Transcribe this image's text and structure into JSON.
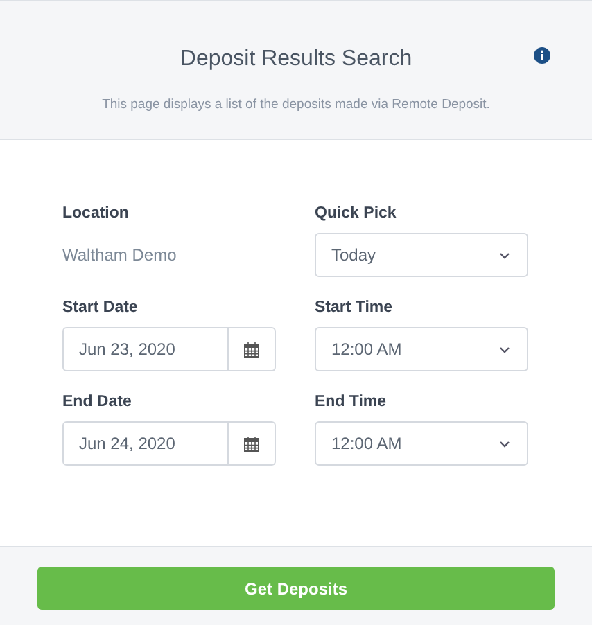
{
  "header": {
    "title": "Deposit Results Search",
    "description": "This page displays a list of the deposits made via Remote Deposit."
  },
  "fields": [
    {
      "label": "Location",
      "kind": "static",
      "value": "Waltham Demo"
    },
    {
      "label": "Quick Pick",
      "kind": "select",
      "value": "Today"
    },
    {
      "label": "Start Date",
      "kind": "date",
      "value": "Jun 23, 2020"
    },
    {
      "label": "Start Time",
      "kind": "select",
      "value": "12:00 AM"
    },
    {
      "label": "End Date",
      "kind": "date",
      "value": "Jun 24, 2020"
    },
    {
      "label": "End Time",
      "kind": "select",
      "value": "12:00 AM"
    }
  ],
  "button": {
    "label": "Get Deposits"
  }
}
